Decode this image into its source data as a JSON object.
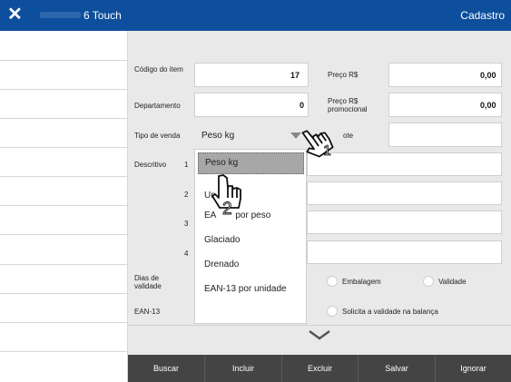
{
  "header": {
    "title": "6 Touch",
    "right_label": "Cadastro",
    "close_icon": "close-icon"
  },
  "form": {
    "codigo_label": "Código do item",
    "codigo_value": "17",
    "preco_label": "Preço R$",
    "preco_value": "0,00",
    "departamento_label": "Departamento",
    "departamento_value": "0",
    "preco_promo_label": "Preço R$ promocional",
    "preco_promo_value": "0,00",
    "tipo_label": "Tipo de venda",
    "tipo_value": "Peso kg",
    "lote_label_partial": "ote",
    "descritivo_label": "Descritivo",
    "desc_indexes": [
      "1",
      "2",
      "3",
      "4"
    ],
    "dias_label": "Dias de validade",
    "ean_label": "EAN-13",
    "embalagem_label": "Embalagem",
    "validade_label": "Validade",
    "solicita_label": "Solicita a validade na balança"
  },
  "dropdown": {
    "options": [
      "Peso kg",
      "Un",
      "EAN-13 por peso",
      "Glaciado",
      "Drenado",
      "EAN-13 por unidade"
    ],
    "visible_text": [
      "Peso kg",
      "Un",
      "EA",
      "por peso",
      "Glaciado",
      "Drenado",
      "EAN-13 por unidade"
    ],
    "selected": "Peso kg"
  },
  "cursor_labels": {
    "first": "1",
    "second": "2"
  },
  "buttons": {
    "buscar": "Buscar",
    "incluir": "Incluir",
    "excluir": "Excluir",
    "salvar": "Salvar",
    "ignorar": "Ignorar"
  },
  "icons": {
    "chevron": "chevron-down-icon",
    "hand": "hand-pointer-icon"
  }
}
